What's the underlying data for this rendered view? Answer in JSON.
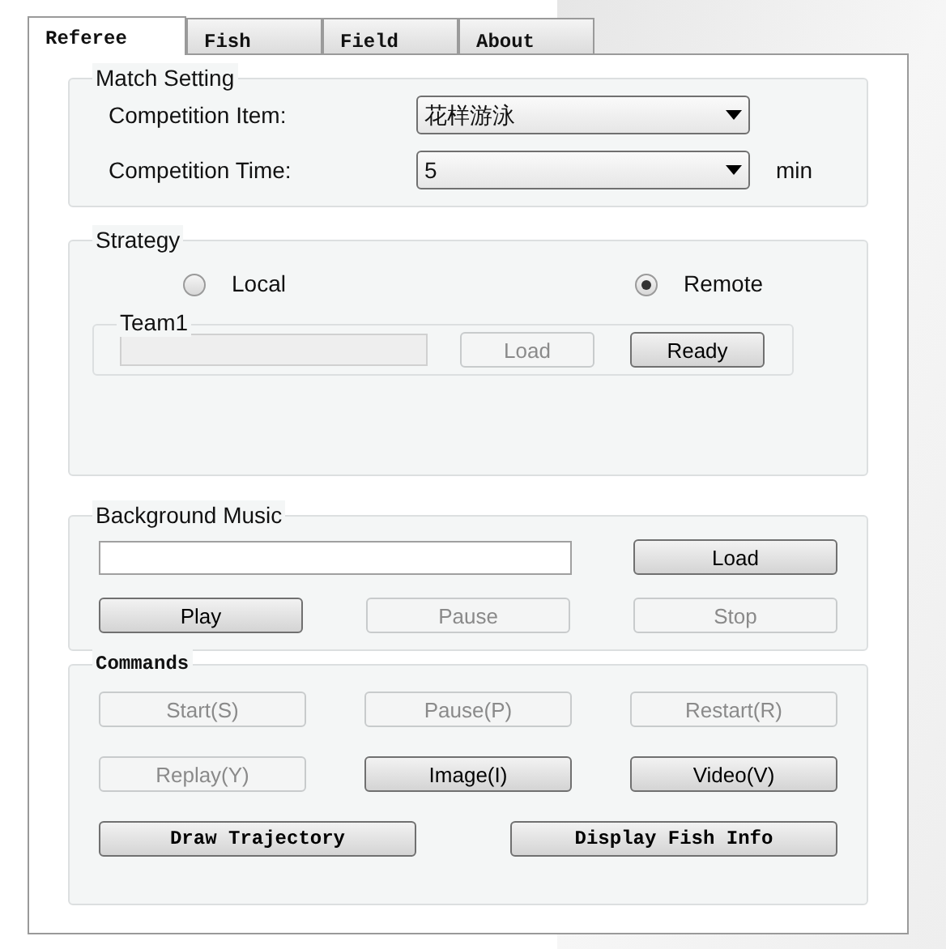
{
  "tabs": [
    {
      "label": "Referee",
      "selected": true
    },
    {
      "label": "Fish",
      "selected": false
    },
    {
      "label": "Field",
      "selected": false
    },
    {
      "label": "About",
      "selected": false
    }
  ],
  "match_setting": {
    "title": "Match Setting",
    "rows": [
      {
        "label": "Competition Item:",
        "value": "花样游泳"
      },
      {
        "label": "Competition Time:",
        "value": "5",
        "unit": "min"
      }
    ]
  },
  "strategy": {
    "title": "Strategy",
    "options": [
      {
        "label": "Local",
        "selected": false
      },
      {
        "label": "Remote",
        "selected": true
      }
    ],
    "team": {
      "title": "Team1",
      "field_disabled": true,
      "buttons": [
        {
          "label": "Load",
          "disabled": true
        },
        {
          "label": "Ready",
          "disabled": false
        }
      ]
    }
  },
  "background_music": {
    "title": "Background Music",
    "load": {
      "label": "Load",
      "disabled": false
    },
    "buttons": [
      {
        "label": "Play",
        "disabled": false
      },
      {
        "label": "Pause",
        "disabled": true
      },
      {
        "label": "Stop",
        "disabled": true
      }
    ]
  },
  "commands": {
    "title": "Commands",
    "rows": [
      [
        {
          "label": "Start(S)",
          "disabled": true
        },
        {
          "label": "Pause(P)",
          "disabled": true
        },
        {
          "label": "Restart(R)",
          "disabled": true
        }
      ],
      [
        {
          "label": "Replay(Y)",
          "disabled": true
        },
        {
          "label": "Image(I)",
          "disabled": false
        },
        {
          "label": "Video(V)",
          "disabled": false
        }
      ]
    ],
    "wide_buttons": [
      {
        "label": "Draw Trajectory",
        "disabled": false
      },
      {
        "label": "Display Fish Info",
        "disabled": false
      }
    ]
  }
}
